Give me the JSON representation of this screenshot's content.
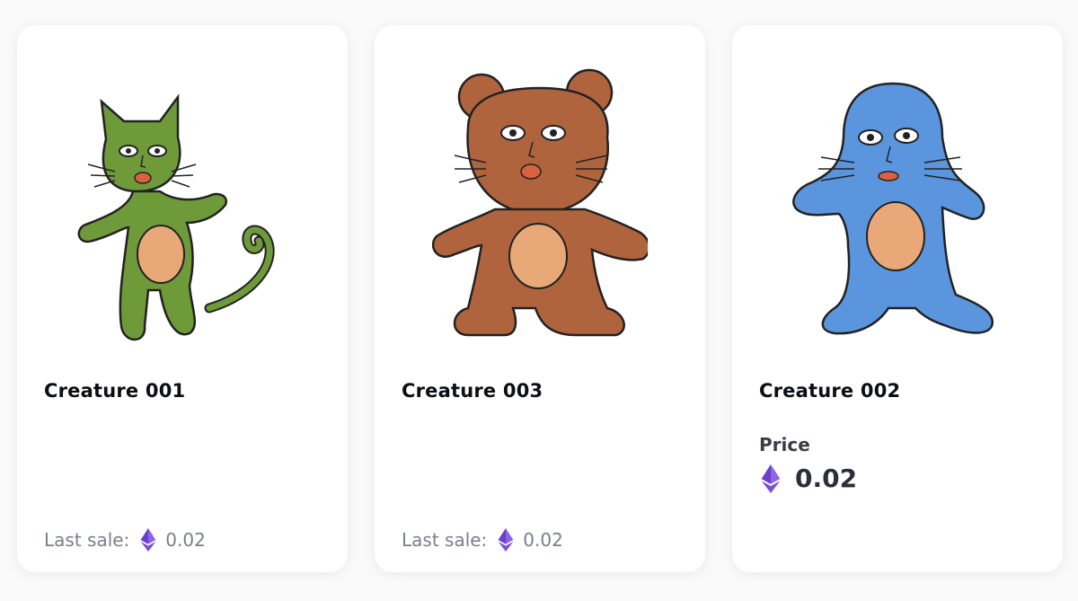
{
  "cards": [
    {
      "title": "Creature 001",
      "art": "green-cat-creature",
      "art_color": "#6f9a3a",
      "last_sale_label": "Last sale:",
      "last_sale_value": "0.02",
      "currency_icon": "ethereum-icon"
    },
    {
      "title": "Creature 003",
      "art": "brown-bear-creature",
      "art_color": "#b0643d",
      "last_sale_label": "Last sale:",
      "last_sale_value": "0.02",
      "currency_icon": "ethereum-icon"
    },
    {
      "title": "Creature 002",
      "art": "blue-seal-creature",
      "art_color": "#5a95dd",
      "price_label": "Price",
      "price_value": "0.02",
      "currency_icon": "ethereum-icon"
    }
  ],
  "colors": {
    "belly": "#e9a877",
    "mouth": "#d9613f",
    "eth": "#7b4fd6",
    "card_bg": "#ffffff",
    "page_bg": "#fafafa"
  }
}
